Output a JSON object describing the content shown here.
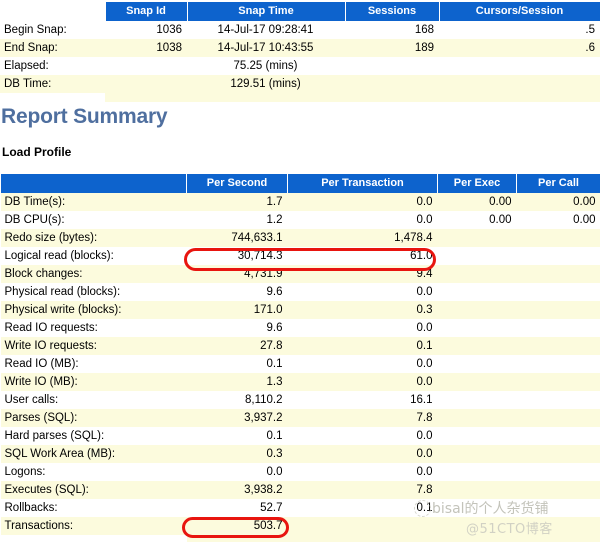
{
  "snap_table": {
    "columns": [
      "",
      "Snap Id",
      "Snap Time",
      "Sessions",
      "Cursors/Session"
    ],
    "rows": [
      {
        "label": "Begin Snap:",
        "snap_id": "1036",
        "snap_time": "14-Jul-17 09:28:41",
        "sessions": "168",
        "cursors": ".5"
      },
      {
        "label": "End Snap:",
        "snap_id": "1038",
        "snap_time": "14-Jul-17 10:43:55",
        "sessions": "189",
        "cursors": ".6"
      },
      {
        "label": "Elapsed:",
        "snap_id": "",
        "snap_time": "75.25 (mins)",
        "sessions": "",
        "cursors": ""
      },
      {
        "label": "DB Time:",
        "snap_id": "",
        "snap_time": "129.51 (mins)",
        "sessions": "",
        "cursors": ""
      }
    ]
  },
  "report_summary_heading": "Report Summary",
  "load_profile_heading": "Load Profile",
  "load_profile_table": {
    "columns": [
      "",
      "Per Second",
      "Per Transaction",
      "Per Exec",
      "Per Call"
    ],
    "rows": [
      {
        "label": "DB Time(s):",
        "per_second": "1.7",
        "per_transaction": "0.0",
        "per_exec": "0.00",
        "per_call": "0.00"
      },
      {
        "label": "DB CPU(s):",
        "per_second": "1.2",
        "per_transaction": "0.0",
        "per_exec": "0.00",
        "per_call": "0.00"
      },
      {
        "label": "Redo size (bytes):",
        "per_second": "744,633.1",
        "per_transaction": "1,478.4",
        "per_exec": "",
        "per_call": ""
      },
      {
        "label": "Logical read (blocks):",
        "per_second": "30,714.3",
        "per_transaction": "61.0",
        "per_exec": "",
        "per_call": ""
      },
      {
        "label": "Block changes:",
        "per_second": "4,731.9",
        "per_transaction": "9.4",
        "per_exec": "",
        "per_call": ""
      },
      {
        "label": "Physical read (blocks):",
        "per_second": "9.6",
        "per_transaction": "0.0",
        "per_exec": "",
        "per_call": ""
      },
      {
        "label": "Physical write (blocks):",
        "per_second": "171.0",
        "per_transaction": "0.3",
        "per_exec": "",
        "per_call": ""
      },
      {
        "label": "Read IO requests:",
        "per_second": "9.6",
        "per_transaction": "0.0",
        "per_exec": "",
        "per_call": ""
      },
      {
        "label": "Write IO requests:",
        "per_second": "27.8",
        "per_transaction": "0.1",
        "per_exec": "",
        "per_call": ""
      },
      {
        "label": "Read IO (MB):",
        "per_second": "0.1",
        "per_transaction": "0.0",
        "per_exec": "",
        "per_call": ""
      },
      {
        "label": "Write IO (MB):",
        "per_second": "1.3",
        "per_transaction": "0.0",
        "per_exec": "",
        "per_call": ""
      },
      {
        "label": "User calls:",
        "per_second": "8,110.2",
        "per_transaction": "16.1",
        "per_exec": "",
        "per_call": ""
      },
      {
        "label": "Parses (SQL):",
        "per_second": "3,937.2",
        "per_transaction": "7.8",
        "per_exec": "",
        "per_call": ""
      },
      {
        "label": "Hard parses (SQL):",
        "per_second": "0.1",
        "per_transaction": "0.0",
        "per_exec": "",
        "per_call": ""
      },
      {
        "label": "SQL Work Area (MB):",
        "per_second": "0.3",
        "per_transaction": "0.0",
        "per_exec": "",
        "per_call": ""
      },
      {
        "label": "Logons:",
        "per_second": "0.0",
        "per_transaction": "0.0",
        "per_exec": "",
        "per_call": ""
      },
      {
        "label": "Executes (SQL):",
        "per_second": "3,938.2",
        "per_transaction": "7.8",
        "per_exec": "",
        "per_call": ""
      },
      {
        "label": "Rollbacks:",
        "per_second": "52.7",
        "per_transaction": "0.1",
        "per_exec": "",
        "per_call": ""
      },
      {
        "label": "Transactions:",
        "per_second": "503.7",
        "per_transaction": "",
        "per_exec": "",
        "per_call": ""
      }
    ]
  },
  "annotations": {
    "color": "#e8150f",
    "highlighted_rows": [
      "Logical read (blocks):",
      "Transactions:"
    ]
  },
  "watermark": {
    "author": "bisal的个人杂货铺",
    "site": "@51CTO博客"
  },
  "colors": {
    "header_blue": "#0d63cd",
    "row_cream": "#fcfbdd",
    "heading_blue": "#4f6f9f",
    "annotation_red": "#e8150f"
  }
}
